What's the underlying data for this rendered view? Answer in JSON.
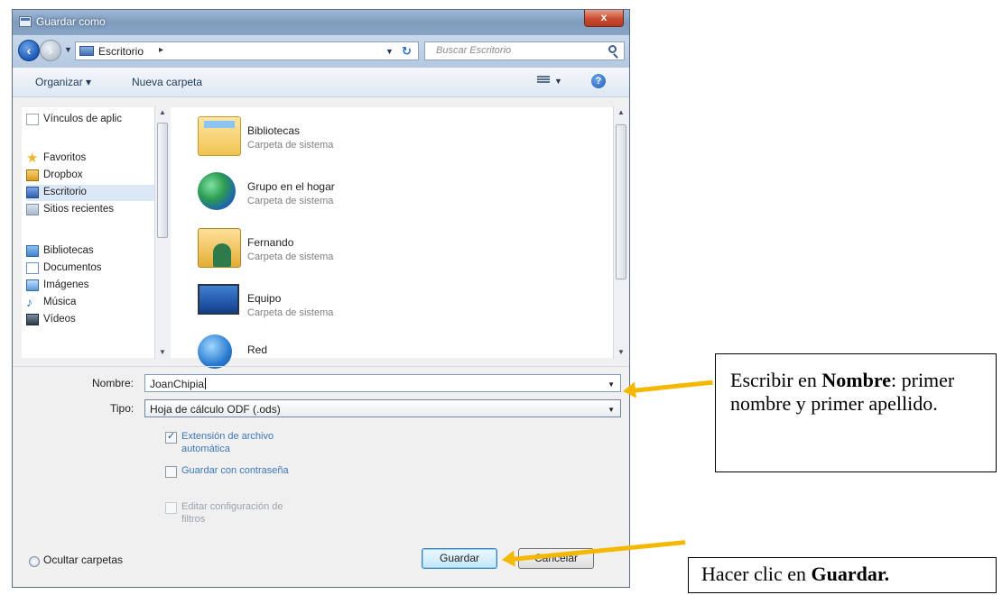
{
  "window": {
    "title": "Guardar como",
    "close_label": "x"
  },
  "navbar": {
    "address_folder": "Escritorio",
    "address_separator": "▸",
    "search_placeholder": "Buscar Escritorio"
  },
  "toolbar": {
    "organize": "Organizar ▾",
    "new_folder": "Nueva carpeta",
    "help": "?"
  },
  "nav_pane": {
    "items": [
      {
        "label": "Vínculos de aplic",
        "icon": "document-icon"
      },
      {
        "label": "Favoritos",
        "icon": "star-icon"
      },
      {
        "label": "Dropbox",
        "icon": "dropbox-icon"
      },
      {
        "label": "Escritorio",
        "icon": "desktop-icon",
        "selected": true
      },
      {
        "label": "Sitios recientes",
        "icon": "recent-places-icon"
      },
      {
        "label": "Bibliotecas",
        "icon": "libraries-icon"
      },
      {
        "label": "Documentos",
        "icon": "documents-icon"
      },
      {
        "label": "Imágenes",
        "icon": "pictures-icon"
      },
      {
        "label": "Música",
        "icon": "music-icon"
      },
      {
        "label": "Vídeos",
        "icon": "videos-icon"
      }
    ]
  },
  "content": {
    "items": [
      {
        "name": "Bibliotecas",
        "sub": "Carpeta de sistema",
        "icon": "libraries-folder-icon"
      },
      {
        "name": "Grupo en el hogar",
        "sub": "Carpeta de sistema",
        "icon": "homegroup-icon"
      },
      {
        "name": "Fernando",
        "sub": "Carpeta de sistema",
        "icon": "user-folder-icon"
      },
      {
        "name": "Equipo",
        "sub": "Carpeta de sistema",
        "icon": "computer-icon"
      },
      {
        "name": "Red",
        "sub": "",
        "icon": "network-icon"
      }
    ]
  },
  "form": {
    "name_label": "Nombre:",
    "name_value": "JoanChipia",
    "type_label": "Tipo:",
    "type_value": "Hoja de cálculo ODF (.ods)",
    "options": [
      {
        "label": "Extensión de archivo automática",
        "checked": true,
        "enabled": true
      },
      {
        "label": "Guardar con contraseña",
        "checked": false,
        "enabled": true
      },
      {
        "label": "Editar configuración de filtros",
        "checked": false,
        "enabled": false
      }
    ]
  },
  "footer": {
    "hide_folders": "Ocultar carpetas",
    "save": "Guardar",
    "cancel": "Cancelar"
  },
  "annotations": {
    "name_prefix": "Escribir en ",
    "name_bold": "Nombre",
    "name_suffix": ": primer nombre y primer apellido.",
    "save_prefix": "Hacer clic en ",
    "save_bold": "Guardar.",
    "arrow_color": "#f5b800"
  }
}
